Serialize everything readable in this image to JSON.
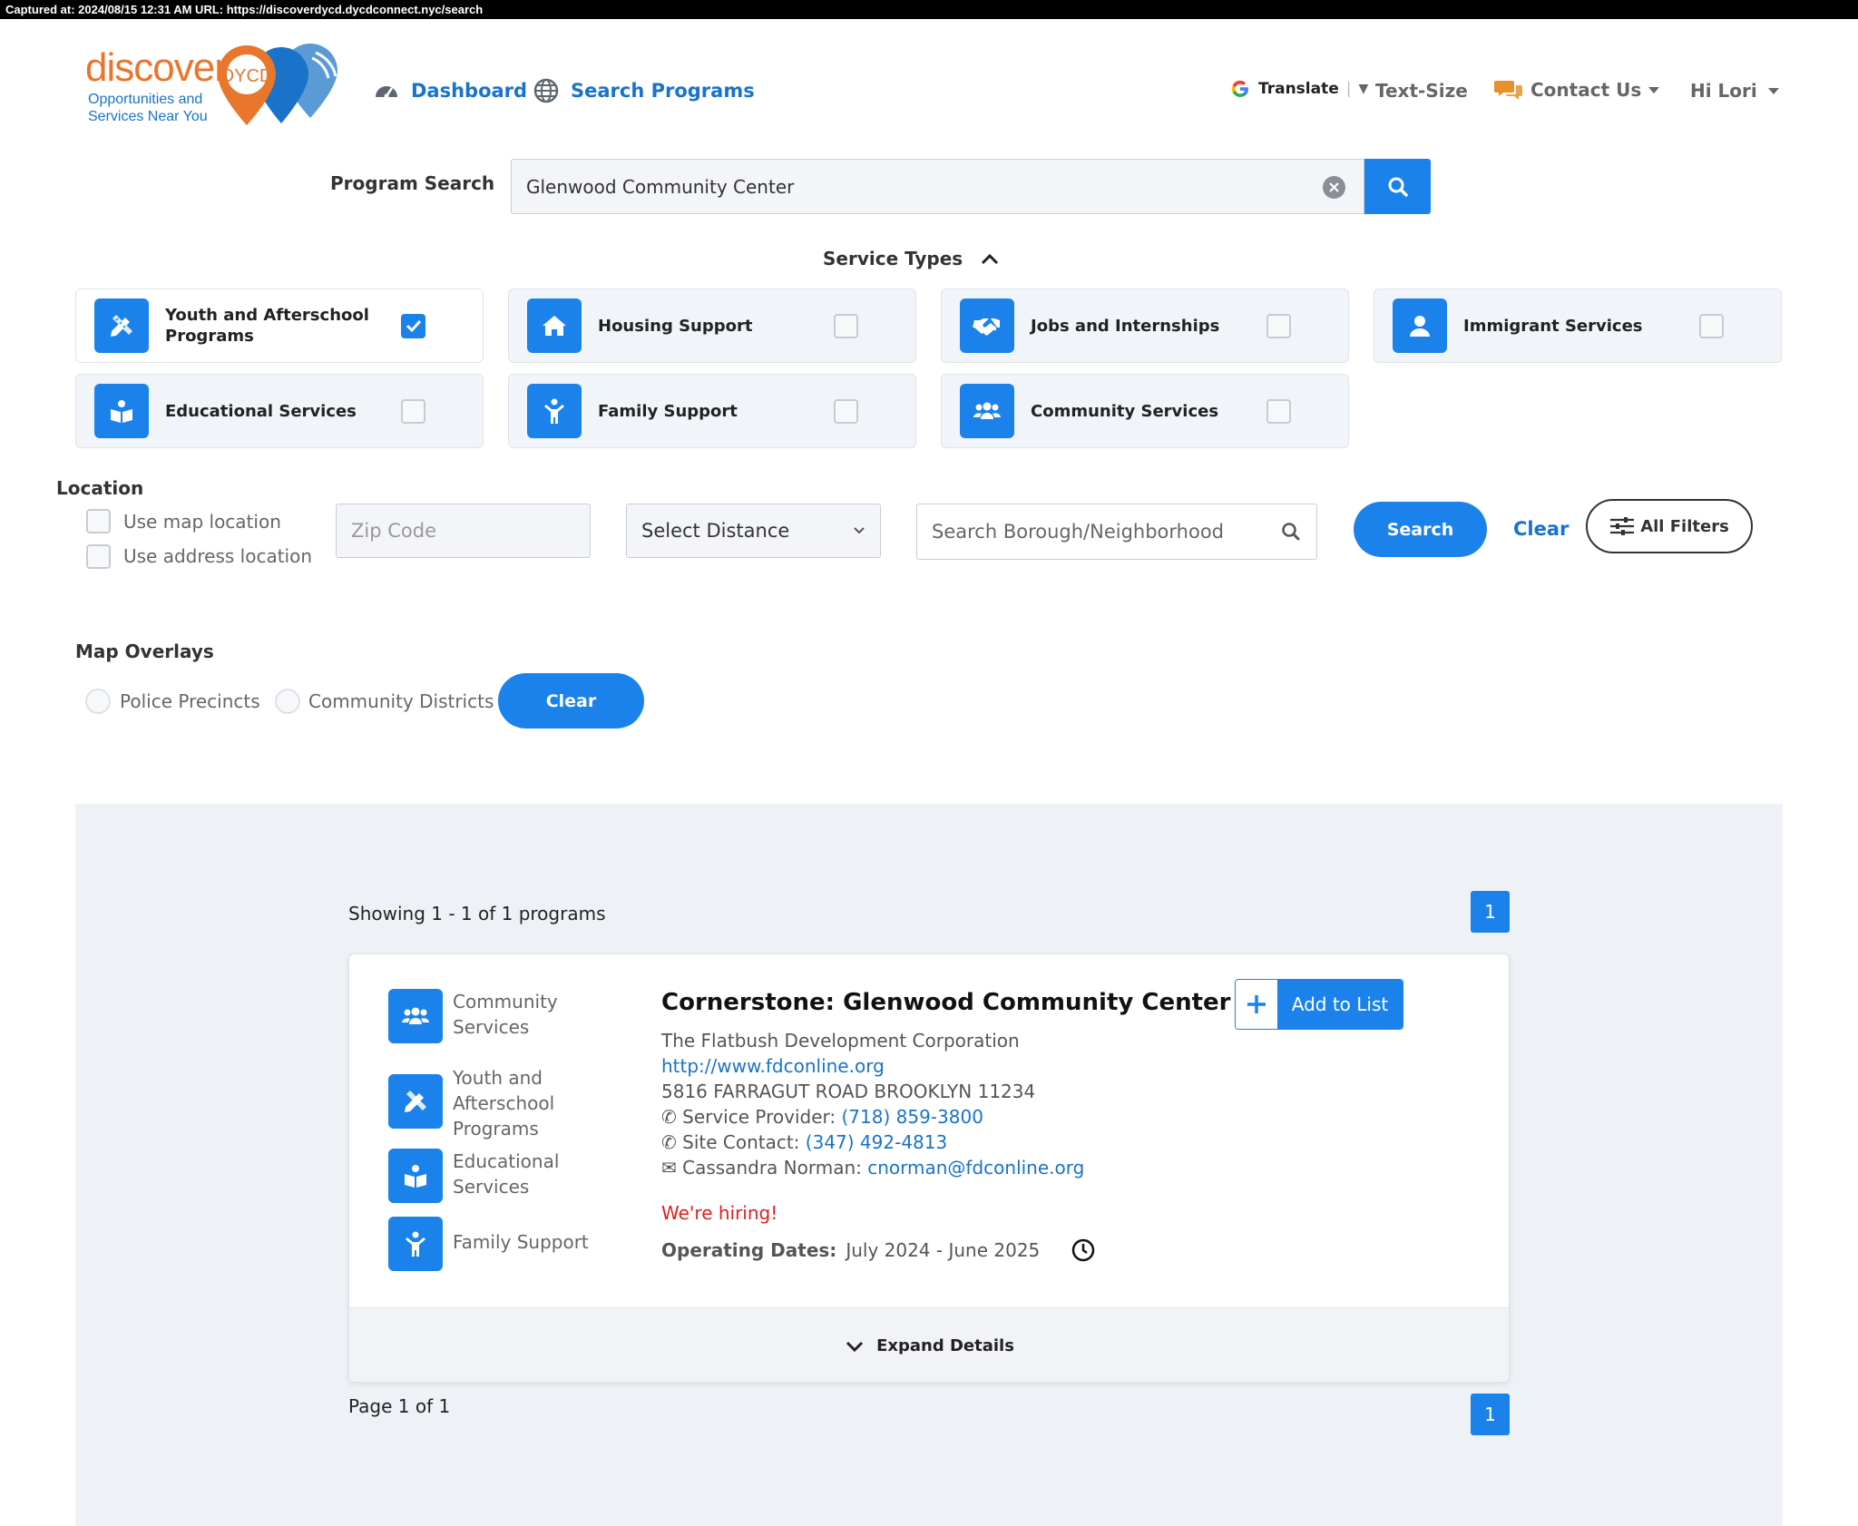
{
  "capture_bar": "Captured at: 2024/08/15 12:31 AM    URL: https://discoverdycd.dycdconnect.nyc/search",
  "logo": {
    "word": "discover",
    "badge": "DYCD",
    "tagline_1": "Opportunities and",
    "tagline_2": "Services Near You"
  },
  "nav": {
    "dashboard": "Dashboard",
    "search_programs": "Search Programs"
  },
  "header_right": {
    "translate": "Translate",
    "text_size": "Text-Size",
    "contact_us": "Contact Us",
    "user": "Hi Lori"
  },
  "search": {
    "label": "Program Search",
    "value": "Glenwood Community Center"
  },
  "service_types": {
    "heading": "Service Types",
    "items": [
      {
        "label": "Youth and Afterschool Programs",
        "icon": "pencil-ruler-icon",
        "checked": true
      },
      {
        "label": "Housing Support",
        "icon": "house-icon",
        "checked": false
      },
      {
        "label": "Jobs and Internships",
        "icon": "handshake-icon",
        "checked": false
      },
      {
        "label": "Immigrant Services",
        "icon": "user-icon",
        "checked": false
      },
      {
        "label": "Educational Services",
        "icon": "book-reader-icon",
        "checked": false
      },
      {
        "label": "Family Support",
        "icon": "child-icon",
        "checked": false
      },
      {
        "label": "Community Services",
        "icon": "users-icon",
        "checked": false
      }
    ]
  },
  "location": {
    "heading": "Location",
    "use_map": "Use map location",
    "use_address": "Use address location",
    "zip_placeholder": "Zip Code",
    "distance": "Select Distance",
    "borough_placeholder": "Search Borough/Neighborhood",
    "search_btn": "Search",
    "clear_btn": "Clear",
    "all_filters": "All Filters"
  },
  "overlays": {
    "heading": "Map Overlays",
    "police": "Police Precincts",
    "community": "Community Districts",
    "clear": "Clear"
  },
  "results": {
    "showing": "Showing 1 - 1 of 1 programs",
    "page_num": "1",
    "page_label": "Page 1 of 1",
    "card": {
      "tags": [
        {
          "label": "Community Services",
          "icon": "users-icon"
        },
        {
          "label": "Youth and Afterschool Programs",
          "icon": "pencil-ruler-icon"
        },
        {
          "label": "Educational Services",
          "icon": "book-reader-icon"
        },
        {
          "label": "Family Support",
          "icon": "child-icon"
        }
      ],
      "title": "Cornerstone: Glenwood Community Center",
      "org": "The Flatbush Development Corporation",
      "url": "http://www.fdconline.org",
      "address": "5816 FARRAGUT ROAD BROOKLYN 11234",
      "provider_label": "Service Provider:",
      "provider_phone": "(718) 859-3800",
      "site_label": "Site Contact:",
      "site_phone": "(347) 492-4813",
      "contact_name": "Cassandra Norman:",
      "contact_email": "cnorman@fdconline.org",
      "hiring": "We're hiring!",
      "dates_label": "Operating Dates:",
      "dates_value": "July 2024 - June 2025",
      "add_to_list": "Add to List",
      "expand": "Expand Details"
    }
  },
  "colors": {
    "primary": "#1a82ea",
    "link": "#1a73c9",
    "orange": "#e8762c",
    "hiring": "#e02020"
  }
}
